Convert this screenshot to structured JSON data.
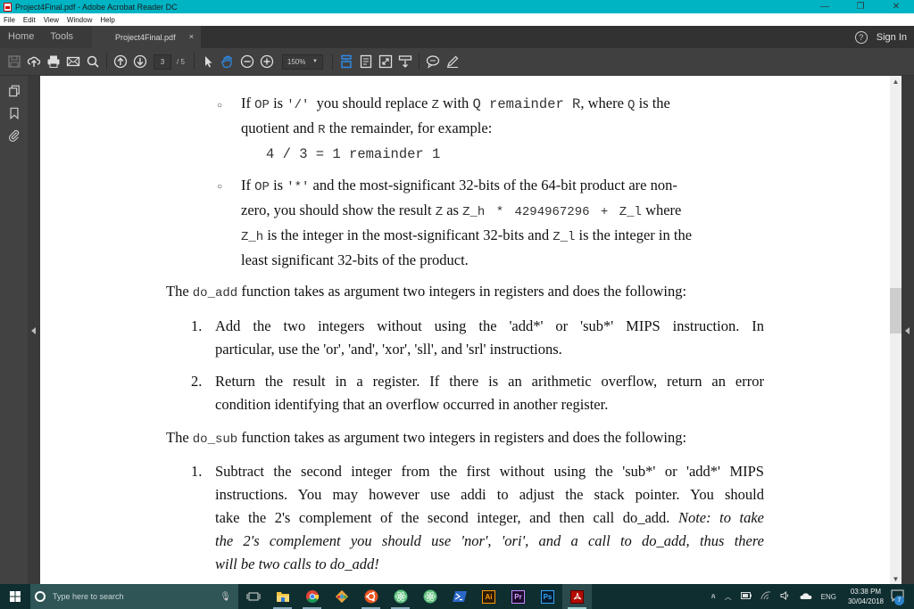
{
  "window": {
    "title": "Project4Final.pdf - Adobe Acrobat Reader DC",
    "controls": {
      "minimize": "—",
      "restore": "❐",
      "close": "✕"
    }
  },
  "menu": [
    "File",
    "Edit",
    "View",
    "Window",
    "Help"
  ],
  "tabs": {
    "home": "Home",
    "tools": "Tools",
    "document": "Project4Final.pdf",
    "close": "×",
    "help": "?",
    "sign_in": "Sign In"
  },
  "toolbar": {
    "icons": [
      "save-icon",
      "upload-cloud-icon",
      "print-icon",
      "email-icon",
      "search-icon",
      "page-up-icon",
      "page-down-icon",
      "select-arrow-icon",
      "hand-tool-icon",
      "zoom-out-icon",
      "zoom-in-icon",
      "fit-page-icon",
      "page-thumbnail-icon",
      "fullscreen-icon",
      "read-mode-icon",
      "comment-icon",
      "highlight-pen-icon"
    ],
    "current_page": "3",
    "total_pages": "/ 5",
    "zoom": "150%",
    "accent": "#2d8ceb"
  },
  "left_panel": [
    "page-thumbnails-icon",
    "bookmark-icon",
    "attachment-icon"
  ],
  "document": {
    "bullet1": {
      "line1_pre": "If ",
      "op": "OP",
      "is": " is ",
      "slash": "'/'",
      "mid": "  you should replace ",
      "z": "Z",
      "with": " with ",
      "qrem": "Q remainder R",
      "where": ", where ",
      "q": "Q",
      "tail": " is the",
      "line2_pre": "quotient and ",
      "r": "R",
      "line2_post": " the remainder, for example:",
      "example": "4 / 3 = 1 remainder 1"
    },
    "bullet2": {
      "line1_pre": "If ",
      "op": "OP",
      "is": " is ",
      "star": "'*'",
      "line1_post": " and the most-significant 32-bits of the 64-bit product are non-",
      "line2_pre": "zero, you should show the result ",
      "z": "Z",
      "as": " as ",
      "formula": "Z_h * 4294967296 + Z_l",
      "line2_post": " where",
      "zh": "Z_h",
      "line3_mid": " is the integer in the most-significant 32-bits and ",
      "zl": "Z_l",
      "line3_post": " is the integer in the",
      "line4": "least significant 32-bits of the product."
    },
    "do_add_intro": {
      "pre": "The ",
      "fn": "do_add",
      "post": " function takes as argument two integers in registers and does the following:"
    },
    "do_add_items": [
      {
        "num": "1.",
        "line1": "Add the two integers without using the 'add*' or 'sub*' MIPS instruction. In",
        "line2": "particular, use the 'or', 'and', 'xor', 'sll', and 'srl' instructions."
      },
      {
        "num": "2.",
        "line1": "Return the result in a register.  If there is an arithmetic overflow, return an error",
        "line2": "condition identifying that an overflow occurred in another register."
      }
    ],
    "do_sub_intro": {
      "pre": "The ",
      "fn": "do_sub",
      "post": " function takes as argument two integers in registers and does the following:"
    },
    "do_sub_items": [
      {
        "num": "1.",
        "line1": "Subtract the second integer from the first without using the 'sub*' or 'add*' MIPS",
        "line2": "instructions. You may however use addi to adjust the stack pointer. You should",
        "line3_plain": "take the 2's complement of the second integer, and then call do_add. ",
        "line3_italic": "Note: to take",
        "line4_italic": "the 2's complement you should use 'nor', 'ori', and a call to do_add, thus there",
        "line5_italic": "will be two calls to do_add!"
      }
    ]
  },
  "taskbar": {
    "search_placeholder": "Type here to search",
    "apps": [
      "file-explorer-icon",
      "chrome-icon",
      "git-icon",
      "ubuntu-icon",
      "atom-icon",
      "atom-icon-2",
      "powershell-icon",
      "illustrator-icon",
      "premiere-icon",
      "photoshop-icon",
      "acrobat-icon"
    ],
    "app_labels": {
      "illustrator": "Ai",
      "premiere": "Pr",
      "photoshop": "Ps"
    },
    "language": "ENG",
    "time": "03:38 PM",
    "date": "30/04/2018",
    "notifications": "7"
  }
}
